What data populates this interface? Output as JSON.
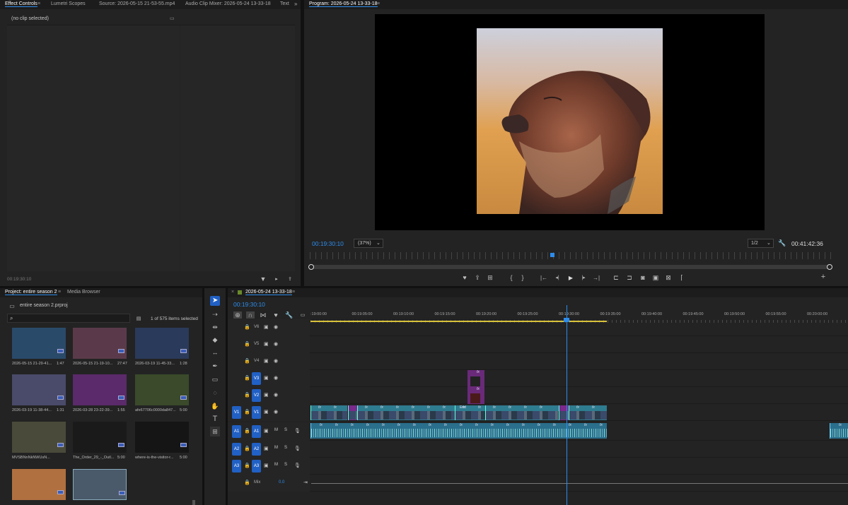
{
  "effect_controls": {
    "tabs": [
      "Effect Controls",
      "Lumetri Scopes",
      "Source: 2026-05-15 21-53-55.mp4",
      "Audio Clip Mixer: 2026-05-24 13-33-18",
      "Text"
    ],
    "no_clip": "(no clip selected)",
    "timecode": "00:19:30:10"
  },
  "program": {
    "title": "Program: 2026-05-24 13-33-18",
    "current_time": "00:19:30:10",
    "zoom": "(37%)",
    "resolution": "1/2",
    "duration": "00:41:42:36"
  },
  "project": {
    "tabs": [
      "Project: entire season 2",
      "Media Browser"
    ],
    "project_file": "entire season 2.prproj",
    "selection": "1 of 575 items selected",
    "items": [
      {
        "name": "2026-05-15 21-29-41...",
        "dur": "1:47",
        "color": "#2a4a6a"
      },
      {
        "name": "2026-05-15 21-19-10...",
        "dur": "27:47",
        "color": "#5a3a4a"
      },
      {
        "name": "2026-03-19 11-45-33...",
        "dur": "1:28",
        "color": "#2a3a5a"
      },
      {
        "name": "2026-03-19 11-38-44...",
        "dur": "1:31",
        "color": "#4a4a6a"
      },
      {
        "name": "2026-03-28 23-22-39...",
        "dur": "1:55",
        "color": "#5a2a6a"
      },
      {
        "name": "afe67706c0000da847...",
        "dur": "5:00",
        "color": "#3a4a2a"
      },
      {
        "name": "MVSBNnNkNWUsN...",
        "dur": "",
        "color": "#4a4a3a"
      },
      {
        "name": "The_Order_29_-_Outl...",
        "dur": "5:00",
        "color": "#1a1a1a"
      },
      {
        "name": "where-is-the-visitor-r...",
        "dur": "5:00",
        "color": "#151515"
      },
      {
        "name": "",
        "dur": "",
        "color": "#b07040"
      },
      {
        "name": "",
        "dur": "",
        "color": "#4a5a6a"
      }
    ]
  },
  "timeline": {
    "sequence": "2026-05-24 13-33-18",
    "timecode": "00:19:30:10",
    "ruler": [
      ":19:00:00",
      "00:19:05:00",
      "00:19:10:00",
      "00:19:15:00",
      "00:19:20:00",
      "00:19:25:00",
      "00:19:30:00",
      "00:19:35:00",
      "00:19:40:00",
      "00:19:45:00",
      "00:19:50:00",
      "00:19:55:00",
      "00:20:00:00"
    ],
    "video_tracks": [
      "V6",
      "V5",
      "V4",
      "V3",
      "V2",
      "V1"
    ],
    "audio_tracks": [
      "A1",
      "A2",
      "A3"
    ],
    "mix_label": "Mix",
    "mix_value": "0.0",
    "clip_label": "End",
    "fx_label": "fx",
    "m_label": "M",
    "s_label": "S"
  }
}
